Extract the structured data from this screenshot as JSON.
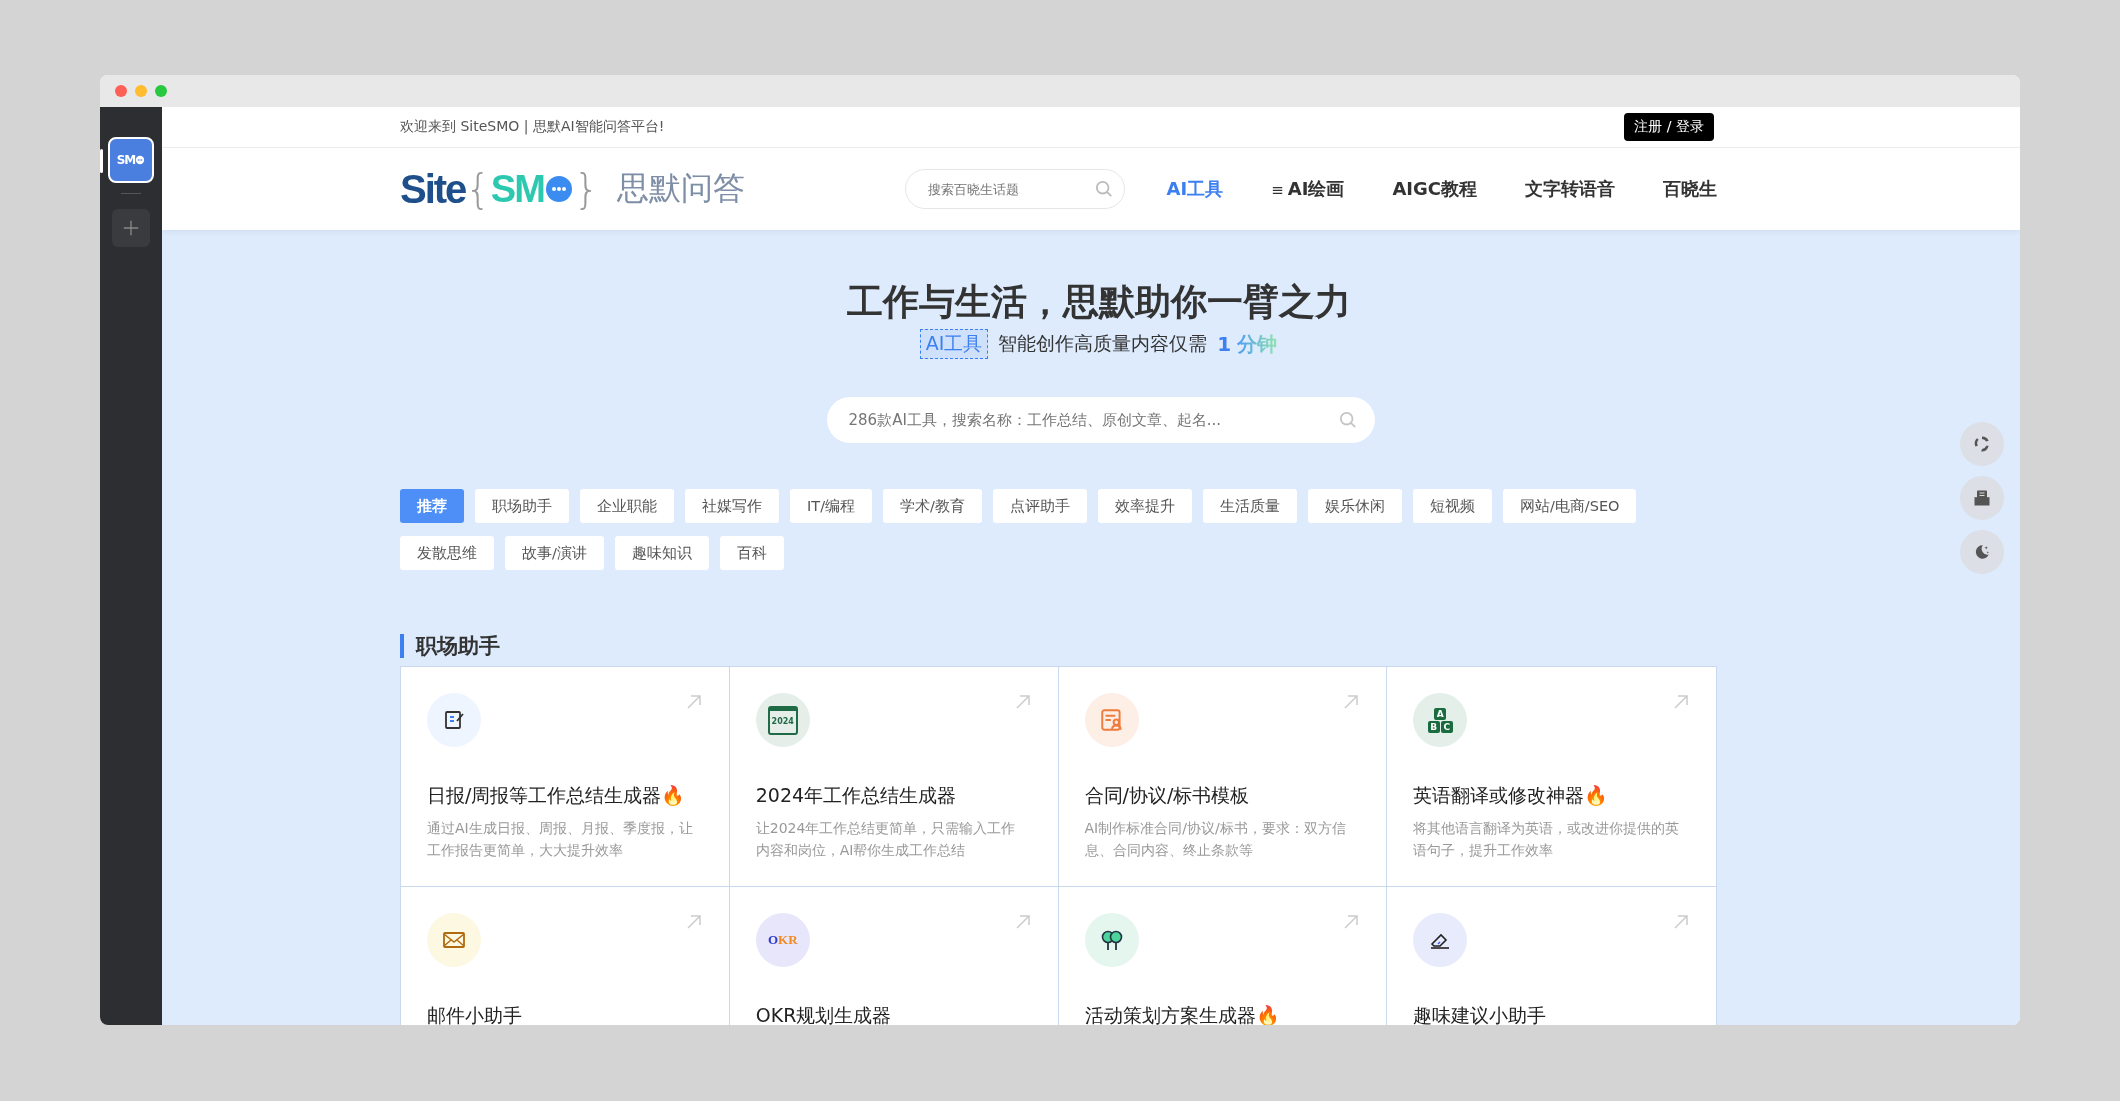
{
  "sidebar": {
    "app": {
      "letters": "SM",
      "selected": true
    }
  },
  "topbar": {
    "welcome": "欢迎来到 SiteSMO | 思默AI智能问答平台!",
    "login": "注册 / 登录"
  },
  "logo": {
    "word": "Site",
    "open": "{",
    "mark": "SM",
    "close": "}",
    "name": "思默问答"
  },
  "header_search": {
    "placeholder": "搜索百晓生话题"
  },
  "nav": [
    {
      "label": "AI工具",
      "selected": true
    },
    {
      "label": "AI绘画",
      "menu_glyph": "≡",
      "selected": false
    },
    {
      "label": "AIGC教程",
      "selected": false
    },
    {
      "label": "文字转语音",
      "selected": false
    },
    {
      "label": "百晓生",
      "selected": false
    }
  ],
  "hero": {
    "title": "工作与生活，思默助你一臂之力",
    "tag": "AI工具",
    "subtitle": "智能创作高质量内容仅需",
    "number": "1",
    "unit": "分钟",
    "search": {
      "placeholder": "286款AI工具，搜索名称：工作总结、原创文章、起名..."
    }
  },
  "tags": [
    {
      "label": "推荐",
      "selected": true
    },
    {
      "label": "职场助手",
      "selected": false
    },
    {
      "label": "企业职能",
      "selected": false
    },
    {
      "label": "社媒写作",
      "selected": false
    },
    {
      "label": "IT/编程",
      "selected": false
    },
    {
      "label": "学术/教育",
      "selected": false
    },
    {
      "label": "点评助手",
      "selected": false
    },
    {
      "label": "效率提升",
      "selected": false
    },
    {
      "label": "生活质量",
      "selected": false
    },
    {
      "label": "娱乐休闲",
      "selected": false
    },
    {
      "label": "短视频",
      "selected": false
    },
    {
      "label": "网站/电商/SEO",
      "selected": false
    },
    {
      "label": "发散思维",
      "selected": false
    },
    {
      "label": "故事/演讲",
      "selected": false
    },
    {
      "label": "趣味知识",
      "selected": false
    },
    {
      "label": "百科",
      "selected": false
    }
  ],
  "section": {
    "title": "职场助手",
    "cards": [
      {
        "kind": "document",
        "title": "日报/周报等工作总结生成器🔥",
        "description": "通过AI生成日报、周报、月报、季度报，让工作报告更简单，大大提升效率"
      },
      {
        "kind": "calendar",
        "icon_text": "2024",
        "title": "2024年工作总结生成器",
        "description": "让2024年工作总结更简单，只需输入工作内容和岗位，AI帮你生成工作总结"
      },
      {
        "kind": "contract",
        "title": "合同/协议/标书模板",
        "description": "AI制作标准合同/协议/标书，要求：双方信息、合同内容、终止条款等"
      },
      {
        "kind": "blocks",
        "icon_letters": [
          "A",
          "B",
          "C"
        ],
        "title": "英语翻译或修改神器🔥",
        "description": "将其他语言翻译为英语，或改进你提供的英语句子，提升工作效率"
      },
      {
        "kind": "mail",
        "title": "邮件小助手"
      },
      {
        "kind": "okr",
        "icon_letters": [
          "O",
          "K",
          "R"
        ],
        "title": "OKR规划生成器"
      },
      {
        "kind": "trees",
        "title": "活动策划方案生成器🔥"
      },
      {
        "kind": "eraser",
        "title": "趣味建议小助手"
      }
    ]
  }
}
